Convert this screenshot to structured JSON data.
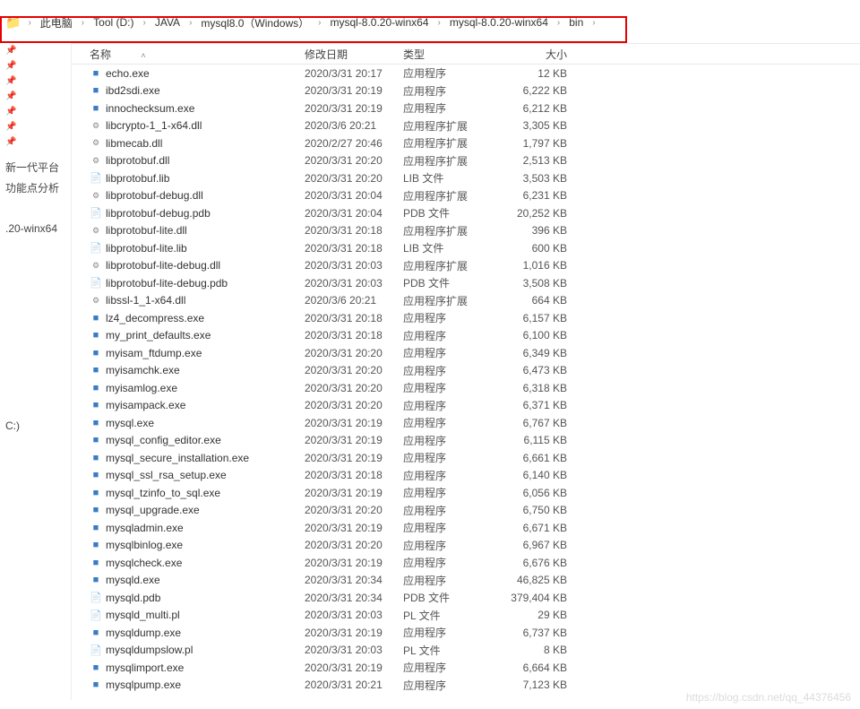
{
  "breadcrumb": [
    "此电脑",
    "Tool (D:)",
    "JAVA",
    "mysql8.0（Windows）",
    "mysql-8.0.20-winx64",
    "mysql-8.0.20-winx64",
    "bin"
  ],
  "columns": {
    "name": "名称",
    "date": "修改日期",
    "type": "类型",
    "size": "大小"
  },
  "sidebar": {
    "items": [
      {
        "label": "新一代平台"
      },
      {
        "label": "功能点分析"
      },
      {
        "label": ".20-winx64"
      },
      {
        "label": "C:)"
      }
    ]
  },
  "files": [
    {
      "icon": "exe",
      "name": "echo.exe",
      "date": "2020/3/31 20:17",
      "type": "应用程序",
      "size": "12 KB"
    },
    {
      "icon": "exe",
      "name": "ibd2sdi.exe",
      "date": "2020/3/31 20:19",
      "type": "应用程序",
      "size": "6,222 KB"
    },
    {
      "icon": "exe",
      "name": "innochecksum.exe",
      "date": "2020/3/31 20:19",
      "type": "应用程序",
      "size": "6,212 KB"
    },
    {
      "icon": "dll",
      "name": "libcrypto-1_1-x64.dll",
      "date": "2020/3/6 20:21",
      "type": "应用程序扩展",
      "size": "3,305 KB"
    },
    {
      "icon": "dll",
      "name": "libmecab.dll",
      "date": "2020/2/27 20:46",
      "type": "应用程序扩展",
      "size": "1,797 KB"
    },
    {
      "icon": "dll",
      "name": "libprotobuf.dll",
      "date": "2020/3/31 20:20",
      "type": "应用程序扩展",
      "size": "2,513 KB"
    },
    {
      "icon": "lib",
      "name": "libprotobuf.lib",
      "date": "2020/3/31 20:20",
      "type": "LIB 文件",
      "size": "3,503 KB"
    },
    {
      "icon": "dll",
      "name": "libprotobuf-debug.dll",
      "date": "2020/3/31 20:04",
      "type": "应用程序扩展",
      "size": "6,231 KB"
    },
    {
      "icon": "pdb",
      "name": "libprotobuf-debug.pdb",
      "date": "2020/3/31 20:04",
      "type": "PDB 文件",
      "size": "20,252 KB"
    },
    {
      "icon": "dll",
      "name": "libprotobuf-lite.dll",
      "date": "2020/3/31 20:18",
      "type": "应用程序扩展",
      "size": "396 KB"
    },
    {
      "icon": "lib",
      "name": "libprotobuf-lite.lib",
      "date": "2020/3/31 20:18",
      "type": "LIB 文件",
      "size": "600 KB"
    },
    {
      "icon": "dll",
      "name": "libprotobuf-lite-debug.dll",
      "date": "2020/3/31 20:03",
      "type": "应用程序扩展",
      "size": "1,016 KB"
    },
    {
      "icon": "pdb",
      "name": "libprotobuf-lite-debug.pdb",
      "date": "2020/3/31 20:03",
      "type": "PDB 文件",
      "size": "3,508 KB"
    },
    {
      "icon": "dll",
      "name": "libssl-1_1-x64.dll",
      "date": "2020/3/6 20:21",
      "type": "应用程序扩展",
      "size": "664 KB"
    },
    {
      "icon": "exe",
      "name": "lz4_decompress.exe",
      "date": "2020/3/31 20:18",
      "type": "应用程序",
      "size": "6,157 KB"
    },
    {
      "icon": "exe",
      "name": "my_print_defaults.exe",
      "date": "2020/3/31 20:18",
      "type": "应用程序",
      "size": "6,100 KB"
    },
    {
      "icon": "exe",
      "name": "myisam_ftdump.exe",
      "date": "2020/3/31 20:20",
      "type": "应用程序",
      "size": "6,349 KB"
    },
    {
      "icon": "exe",
      "name": "myisamchk.exe",
      "date": "2020/3/31 20:20",
      "type": "应用程序",
      "size": "6,473 KB"
    },
    {
      "icon": "exe",
      "name": "myisamlog.exe",
      "date": "2020/3/31 20:20",
      "type": "应用程序",
      "size": "6,318 KB"
    },
    {
      "icon": "exe",
      "name": "myisampack.exe",
      "date": "2020/3/31 20:20",
      "type": "应用程序",
      "size": "6,371 KB"
    },
    {
      "icon": "exe",
      "name": "mysql.exe",
      "date": "2020/3/31 20:19",
      "type": "应用程序",
      "size": "6,767 KB"
    },
    {
      "icon": "exe",
      "name": "mysql_config_editor.exe",
      "date": "2020/3/31 20:19",
      "type": "应用程序",
      "size": "6,115 KB"
    },
    {
      "icon": "exe",
      "name": "mysql_secure_installation.exe",
      "date": "2020/3/31 20:19",
      "type": "应用程序",
      "size": "6,661 KB"
    },
    {
      "icon": "exe",
      "name": "mysql_ssl_rsa_setup.exe",
      "date": "2020/3/31 20:18",
      "type": "应用程序",
      "size": "6,140 KB"
    },
    {
      "icon": "exe",
      "name": "mysql_tzinfo_to_sql.exe",
      "date": "2020/3/31 20:19",
      "type": "应用程序",
      "size": "6,056 KB"
    },
    {
      "icon": "exe",
      "name": "mysql_upgrade.exe",
      "date": "2020/3/31 20:20",
      "type": "应用程序",
      "size": "6,750 KB"
    },
    {
      "icon": "exe",
      "name": "mysqladmin.exe",
      "date": "2020/3/31 20:19",
      "type": "应用程序",
      "size": "6,671 KB"
    },
    {
      "icon": "exe",
      "name": "mysqlbinlog.exe",
      "date": "2020/3/31 20:20",
      "type": "应用程序",
      "size": "6,967 KB"
    },
    {
      "icon": "exe",
      "name": "mysqlcheck.exe",
      "date": "2020/3/31 20:19",
      "type": "应用程序",
      "size": "6,676 KB"
    },
    {
      "icon": "exe",
      "name": "mysqld.exe",
      "date": "2020/3/31 20:34",
      "type": "应用程序",
      "size": "46,825 KB"
    },
    {
      "icon": "pdb",
      "name": "mysqld.pdb",
      "date": "2020/3/31 20:34",
      "type": "PDB 文件",
      "size": "379,404 KB"
    },
    {
      "icon": "pl",
      "name": "mysqld_multi.pl",
      "date": "2020/3/31 20:03",
      "type": "PL 文件",
      "size": "29 KB"
    },
    {
      "icon": "exe",
      "name": "mysqldump.exe",
      "date": "2020/3/31 20:19",
      "type": "应用程序",
      "size": "6,737 KB"
    },
    {
      "icon": "pl",
      "name": "mysqldumpslow.pl",
      "date": "2020/3/31 20:03",
      "type": "PL 文件",
      "size": "8 KB"
    },
    {
      "icon": "exe",
      "name": "mysqlimport.exe",
      "date": "2020/3/31 20:19",
      "type": "应用程序",
      "size": "6,664 KB"
    },
    {
      "icon": "exe",
      "name": "mysqlpump.exe",
      "date": "2020/3/31 20:21",
      "type": "应用程序",
      "size": "7,123 KB"
    }
  ],
  "watermark": "https://blog.csdn.net/qq_44376456"
}
